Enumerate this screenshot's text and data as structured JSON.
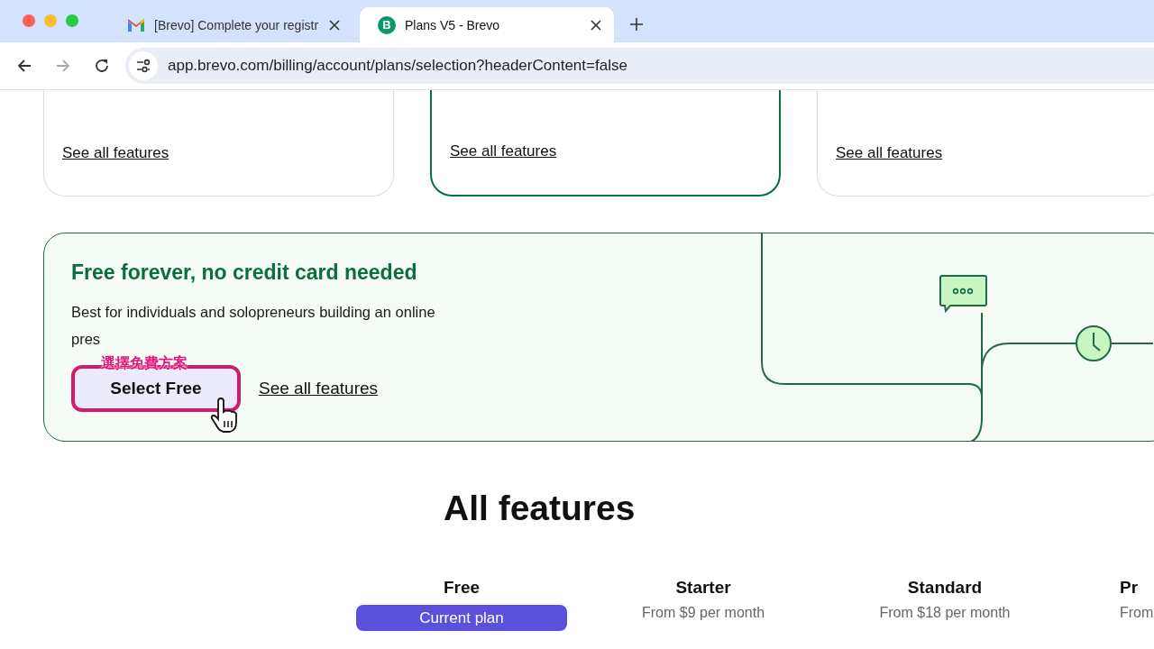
{
  "browser": {
    "tabs": [
      {
        "title": "[Brevo] Complete your registr",
        "selected": false
      },
      {
        "title": "Plans V5 - Brevo",
        "icon_letter": "B",
        "selected": true
      }
    ],
    "forward_disabled": true,
    "url": "app.brevo.com/billing/account/plans/selection?headerContent=false"
  },
  "plan_cards": [
    {
      "link": "See all features",
      "selected": false
    },
    {
      "link": "See all features",
      "selected": true
    },
    {
      "link": "See all features",
      "selected": false
    }
  ],
  "free_banner": {
    "title": "Free forever, no credit card needed",
    "description": "Best for individuals and solopreneurs building an online pres",
    "select_button": {
      "label": "Select Free",
      "highlighted": true
    },
    "link": "See all features",
    "annotation": "選擇免費方案"
  },
  "all_features": {
    "title": "All features",
    "plans": [
      {
        "name": "Free",
        "kind": "current",
        "note": "Current plan"
      },
      {
        "name": "Starter",
        "kind": "price",
        "note": "From $9 per month"
      },
      {
        "name": "Standard",
        "kind": "price",
        "note": "From $18 per month"
      },
      {
        "name": "Pr",
        "kind": "price",
        "note": "From"
      }
    ]
  }
}
